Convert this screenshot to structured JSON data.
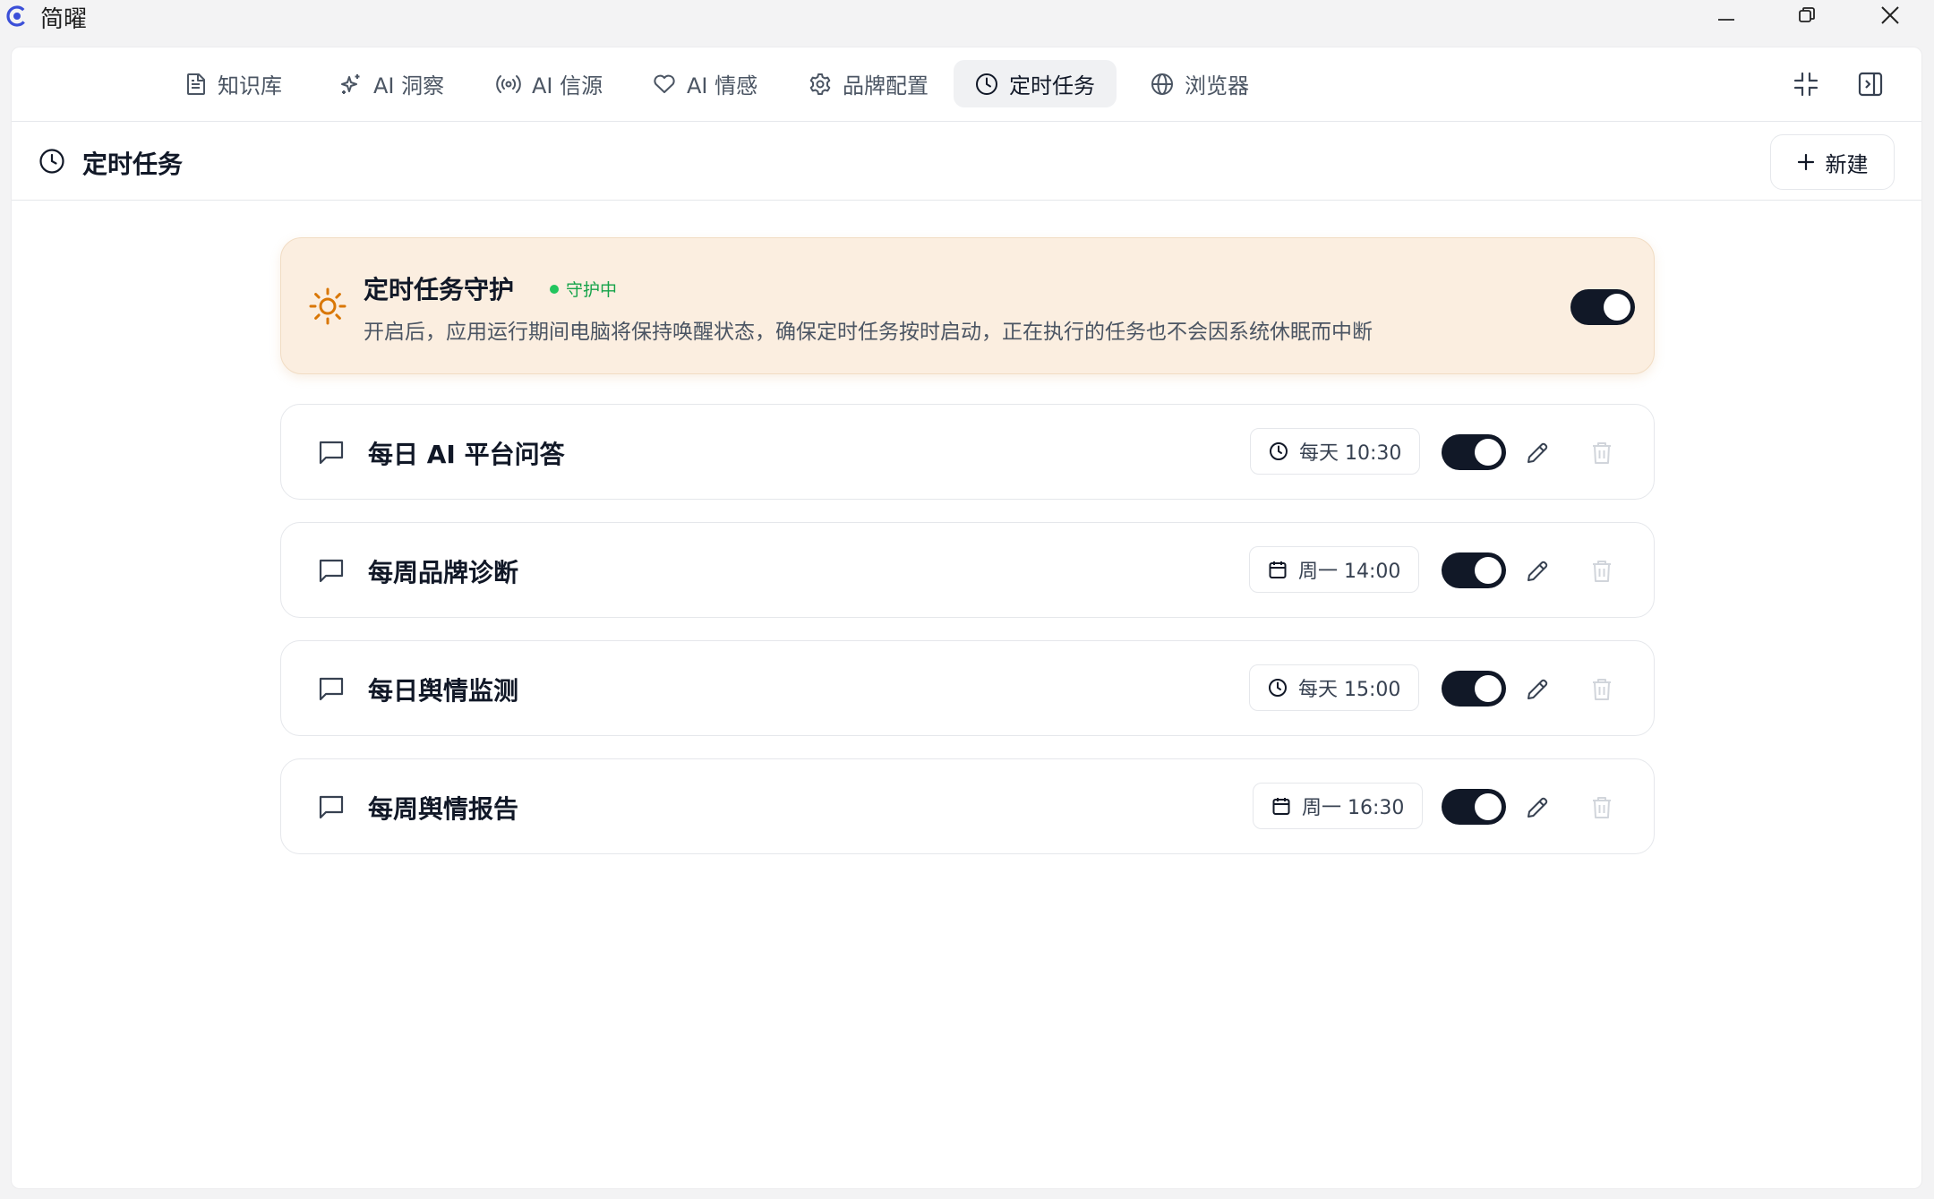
{
  "window": {
    "app_title": "简曜"
  },
  "nav": {
    "tabs": [
      {
        "label": "知识库",
        "icon": "file-text-icon"
      },
      {
        "label": "AI 洞察",
        "icon": "sparkles-icon"
      },
      {
        "label": "AI 信源",
        "icon": "radio-icon"
      },
      {
        "label": "AI 情感",
        "icon": "heart-icon"
      },
      {
        "label": "品牌配置",
        "icon": "gear-icon"
      },
      {
        "label": "定时任务",
        "icon": "clock-icon",
        "active": true
      },
      {
        "label": "浏览器",
        "icon": "globe-icon"
      }
    ]
  },
  "page": {
    "title": "定时任务",
    "new_label": "新建"
  },
  "guardian": {
    "title": "定时任务守护",
    "status": "守护中",
    "description": "开启后，应用运行期间电脑将保持唤醒状态，确保定时任务按时启动，正在执行的任务也不会因系统休眠而中断",
    "enabled": true
  },
  "tasks": [
    {
      "name": "每日 AI 平台问答",
      "schedule": "每天 10:30",
      "schedule_icon": "clock-icon",
      "enabled": true
    },
    {
      "name": "每周品牌诊断",
      "schedule": "周一 14:00",
      "schedule_icon": "calendar-icon",
      "enabled": true
    },
    {
      "name": "每日舆情监测",
      "schedule": "每天 15:00",
      "schedule_icon": "clock-icon",
      "enabled": true
    },
    {
      "name": "每周舆情报告",
      "schedule": "周一 16:30",
      "schedule_icon": "calendar-icon",
      "enabled": true
    }
  ],
  "colors": {
    "accent_dark": "#111827",
    "guardian_bg": "#fbeee0",
    "guardian_icon": "#d97706",
    "status_green": "#16a34a"
  }
}
